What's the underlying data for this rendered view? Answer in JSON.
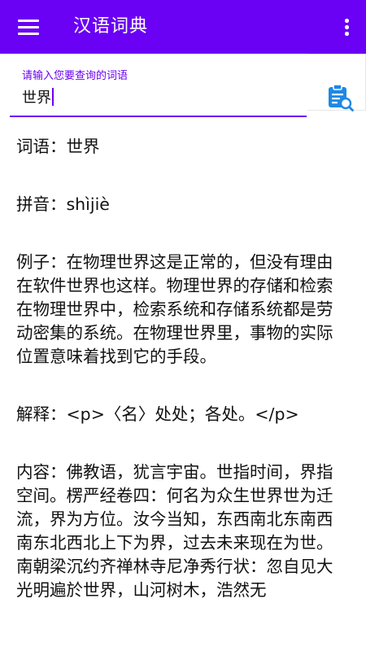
{
  "appbar": {
    "title": "汉语词典",
    "background_color": "#6a00f4",
    "menu_icon": "hamburger-menu-icon",
    "overflow_icon": "more-vertical-icon"
  },
  "search": {
    "label": "请输入您要查询的词语",
    "value": "世界",
    "button_icon": "clipboard-search-icon",
    "accent_color": "#6a00f4",
    "icon_color": "#1e88e5"
  },
  "result": {
    "word": "词语：世界",
    "pinyin": "拼音：shìjiè",
    "example": "例子：在物理世界这是正常的，但没有理由在软件世界也这样。物理世界的存储和检索在物理世界中，检索系统和存储系统都是劳动密集的系统。在物理世界里，事物的实际位置意味着找到它的手段。",
    "explanation": "解释：<p>〈名〉处处；各处。</p>",
    "detail": "内容：佛教语，犹言宇宙。世指时间，界指空间。楞严经卷四：何名为众生世界世为迁流，界为方位。汝今当知，东西南北东南西南东北西北上下为界，过去未来现在为世。南朝梁沉约齐禅林寺尼净秀行状：忽自见大光明遍於世界，山河树木，浩然无"
  }
}
